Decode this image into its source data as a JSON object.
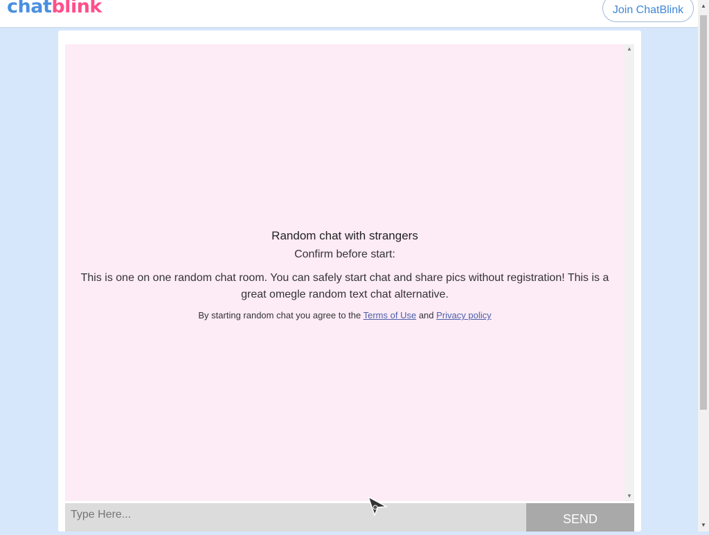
{
  "header": {
    "logo_part1": "chat",
    "logo_part2": "blink",
    "join_button": "Join ChatBlink"
  },
  "intro": {
    "title": "Random chat with strangers",
    "confirm": "Confirm before start:",
    "description": "This is one on one random chat room. You can safely start chat and share pics without registration! This is a great omegle random text chat alternative.",
    "agree_prefix": "By starting random chat you agree to the ",
    "terms_link": "Terms of Use",
    "agree_and": " and ",
    "privacy_link": "Privacy policy"
  },
  "composer": {
    "placeholder": "Type Here...",
    "send_button": "SEND"
  },
  "colors": {
    "background": "#d6e6fb",
    "chat_background": "#fdebf6",
    "logo_blue": "#4a8fe0",
    "logo_pink": "#ff4f8b",
    "send_button": "#a9a9a9"
  }
}
